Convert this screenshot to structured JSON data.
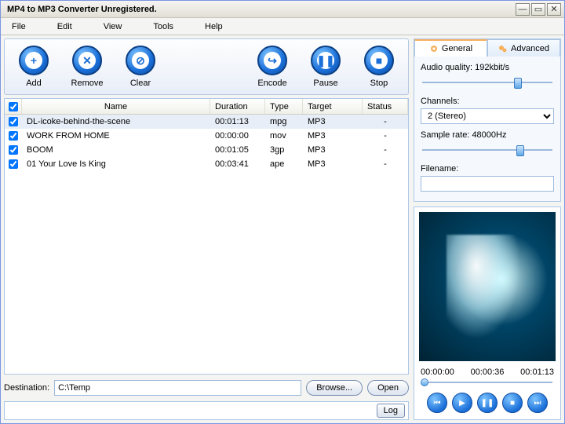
{
  "title": "MP4 to MP3 Converter Unregistered.",
  "menu": [
    "File",
    "Edit",
    "View",
    "Tools",
    "Help"
  ],
  "toolbar": {
    "add": "Add",
    "remove": "Remove",
    "clear": "Clear",
    "encode": "Encode",
    "pause": "Pause",
    "stop": "Stop"
  },
  "columns": {
    "name": "Name",
    "duration": "Duration",
    "type": "Type",
    "target": "Target",
    "status": "Status"
  },
  "rows": [
    {
      "checked": true,
      "name": "DL-icoke-behind-the-scene",
      "duration": "00:01:13",
      "type": "mpg",
      "target": "MP3",
      "status": "-",
      "selected": true
    },
    {
      "checked": true,
      "name": "WORK FROM HOME",
      "duration": "00:00:00",
      "type": "mov",
      "target": "MP3",
      "status": "-"
    },
    {
      "checked": true,
      "name": "BOOM",
      "duration": "00:01:05",
      "type": "3gp",
      "target": "MP3",
      "status": "-"
    },
    {
      "checked": true,
      "name": "01 Your Love Is King",
      "duration": "00:03:41",
      "type": "ape",
      "target": "MP3",
      "status": "-"
    }
  ],
  "destination": {
    "label": "Destination:",
    "value": "C:\\Temp",
    "browse": "Browse...",
    "open": "Open"
  },
  "log": "Log",
  "tabs": {
    "general": "General",
    "advanced": "Advanced"
  },
  "settings": {
    "quality_label": "Audio quality:",
    "quality_value": "192kbit/s",
    "channels_label": "Channels:",
    "channels_value": "2 (Stereo)",
    "sample_label": "Sample rate:",
    "sample_value": "48000Hz",
    "filename_label": "Filename:",
    "filename_value": ""
  },
  "preview": {
    "t0": "00:00:00",
    "t1": "00:00:36",
    "t2": "00:01:13"
  }
}
